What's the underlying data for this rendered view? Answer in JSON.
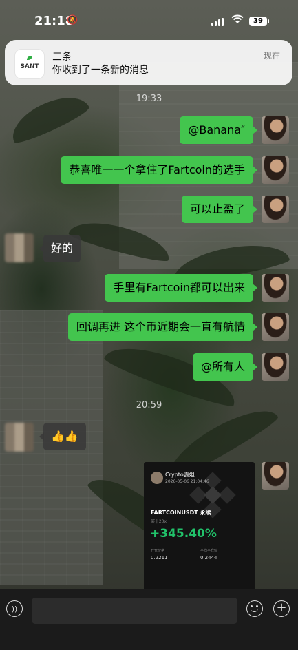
{
  "status_bar": {
    "time": "21:18",
    "battery": "39"
  },
  "notification": {
    "app_icon_text": "SANT",
    "title": "三条",
    "body": "你收到了一条新的消息",
    "time": "现在"
  },
  "timestamps": [
    "19:33",
    "20:59"
  ],
  "messages": [
    {
      "side": "out",
      "text": "@Banana″"
    },
    {
      "side": "out",
      "text": "恭喜唯一一个拿住了Fartcoin的选手"
    },
    {
      "side": "out",
      "text": "可以止盈了"
    },
    {
      "side": "in",
      "text": "好的"
    },
    {
      "side": "out",
      "text": "手里有Fartcoin都可以出来"
    },
    {
      "side": "out",
      "text": "回调再进 这个币近期会一直有航情"
    },
    {
      "side": "out",
      "text": "@所有人"
    },
    {
      "side": "in",
      "text": "👍👍"
    }
  ],
  "trade_card": {
    "author": "Crypto露姐",
    "datetime": "2026-05-06 21:04:46",
    "pair": "FARTCOINUSDT 永续",
    "meta": "买 | 20x",
    "pnl": "+345.40%",
    "entry_label": "开仓价格",
    "entry_price": "0.2211",
    "mark_label": "平均平仓价",
    "mark_price": "0.2444"
  },
  "input_bar": {
    "placeholder": ""
  },
  "colors": {
    "out_bubble": "#43c54e",
    "pnl_green": "#21c26a",
    "input_bar_bg": "#1b1b1b"
  }
}
